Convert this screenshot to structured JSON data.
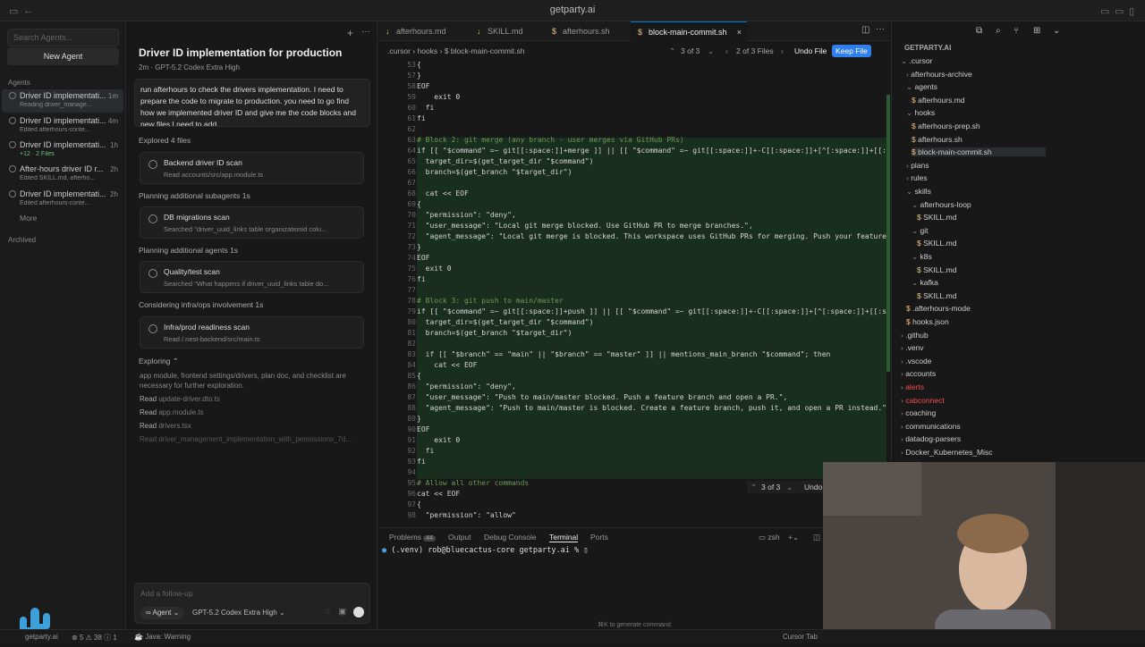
{
  "window": {
    "title": "getparty.ai"
  },
  "sidebar": {
    "search_placeholder": "Search Agents...",
    "new_agent": "New Agent",
    "agents_header": "Agents",
    "archived": "Archived",
    "more": "More",
    "items": [
      {
        "title": "Driver ID implementati...",
        "sub": "Reading driver_manage...",
        "time": "1m"
      },
      {
        "title": "Driver ID implementati...",
        "sub": "Edited afterhours-conte...",
        "time": "4m"
      },
      {
        "title": "Driver ID implementati...",
        "sub": "+12 · 2 Files",
        "time": "1h"
      },
      {
        "title": "After-hours driver ID r...",
        "sub": "Edited SKILL.md, afterho...",
        "time": "2h"
      },
      {
        "title": "Driver ID implementati...",
        "sub": "Edited afterhours-conte...",
        "time": "2h"
      }
    ]
  },
  "chat": {
    "title": "Driver ID implementation for production",
    "meta": "2m · GPT-5.2 Codex Extra High",
    "prompt": "run afterhours to check the drivers implementation. I need to prepare the code to migrate to production.  you need to go find how we implemented driver ID and give me the code blocks and new files I need to add",
    "explored": "Explored 4 files",
    "cards": [
      {
        "title": "Backend driver ID scan",
        "desc": "Read accounts/src/app.module.ts"
      },
      {
        "title": "DB migrations scan",
        "desc": "Searched \"driver_uuid_links table organizationid colu..."
      },
      {
        "title": "Quality/test scan",
        "desc": "Searched \"What happens if driver_uuid_links table do..."
      },
      {
        "title": "Infra/prod readiness scan",
        "desc": "Read /.nest-backend/src/main.ts"
      }
    ],
    "steps": [
      "Planning additional subagents 1s",
      "Planning additional agents 1s",
      "Considering infra/ops involvement 1s"
    ],
    "exploring": "Exploring",
    "exploring_text": "app module, frontend settings/drivers, plan doc, and checklist are necessary for further exploration.",
    "reads": [
      {
        "label": "Read",
        "file": "update-driver.dto.ts"
      },
      {
        "label": "Read",
        "file": "app.module.ts"
      },
      {
        "label": "Read",
        "file": "drivers.tsx"
      },
      {
        "label": "Read",
        "file": "driver_management_implementation_with_permissions_7d..."
      }
    ],
    "followup_placeholder": "Add a follow-up",
    "mode": "Agent",
    "model": "GPT-5.2 Codex Extra High"
  },
  "editor": {
    "tabs": [
      "afterhours.md",
      "SKILL.md",
      "afterhours.sh",
      "block-main-commit.sh"
    ],
    "breadcrumb": ".cursor  ›  hooks  ›  $ block-main-commit.sh",
    "hunk_nav": "3 of 3",
    "file_nav": "2 of 3 Files",
    "undo_file": "Undo File",
    "keep_file": "Keep File",
    "hunk_nav_bottom": "3 of 3",
    "undo": "Undo",
    "lines": [
      {
        "n": "53",
        "t": "{"
      },
      {
        "n": "57",
        "t": "}"
      },
      {
        "n": "58",
        "t": "EOF"
      },
      {
        "n": "59",
        "t": "    exit 0"
      },
      {
        "n": "60",
        "t": "  fi"
      },
      {
        "n": "61",
        "t": "fi"
      },
      {
        "n": "62",
        "t": ""
      },
      {
        "n": "63",
        "t": "# Block 2: git merge (any branch - user merges via GitHub PRs)"
      },
      {
        "n": "64",
        "t": "if [[ \"$command\" =~ git[[:space:]]+merge ]] || [[ \"$command\" =~ git[[:space:]]+-C[[:space:]]+[^[:space:]]+[[:s"
      },
      {
        "n": "65",
        "t": "  target_dir=$(get_target_dir \"$command\")"
      },
      {
        "n": "66",
        "t": "  branch=$(get_branch \"$target_dir\")"
      },
      {
        "n": "67",
        "t": ""
      },
      {
        "n": "68",
        "t": "  cat << EOF"
      },
      {
        "n": "69",
        "t": "{"
      },
      {
        "n": "70",
        "t": "  \"permission\": \"deny\","
      },
      {
        "n": "71",
        "t": "  \"user_message\": \"Local git merge blocked. Use GitHub PR to merge branches.\","
      },
      {
        "n": "72",
        "t": "  \"agent_message\": \"Local git merge is blocked. This workspace uses GitHub PRs for merging. Push your feature"
      },
      {
        "n": "73",
        "t": "}"
      },
      {
        "n": "74",
        "t": "EOF"
      },
      {
        "n": "75",
        "t": "  exit 0"
      },
      {
        "n": "76",
        "t": "fi"
      },
      {
        "n": "77",
        "t": ""
      },
      {
        "n": "78",
        "t": "# Block 3: git push to main/master"
      },
      {
        "n": "79",
        "t": "if [[ \"$command\" =~ git[[:space:]]+push ]] || [[ \"$command\" =~ git[[:space:]]+-C[[:space:]]+[^[:space:]]+[[:sp"
      },
      {
        "n": "80",
        "t": "  target_dir=$(get_target_dir \"$command\")"
      },
      {
        "n": "81",
        "t": "  branch=$(get_branch \"$target_dir\")"
      },
      {
        "n": "82",
        "t": ""
      },
      {
        "n": "83",
        "t": "  if [[ \"$branch\" == \"main\" || \"$branch\" == \"master\" ]] || mentions_main_branch \"$command\"; then"
      },
      {
        "n": "84",
        "t": "    cat << EOF"
      },
      {
        "n": "85",
        "t": "{"
      },
      {
        "n": "86",
        "t": "  \"permission\": \"deny\","
      },
      {
        "n": "87",
        "t": "  \"user_message\": \"Push to main/master blocked. Push a feature branch and open a PR.\","
      },
      {
        "n": "88",
        "t": "  \"agent_message\": \"Push to main/master is blocked. Create a feature branch, push it, and open a PR instead.\""
      },
      {
        "n": "89",
        "t": "}"
      },
      {
        "n": "90",
        "t": "EOF"
      },
      {
        "n": "91",
        "t": "    exit 0"
      },
      {
        "n": "92",
        "t": "  fi"
      },
      {
        "n": "93",
        "t": "fi"
      },
      {
        "n": "94",
        "t": ""
      },
      {
        "n": "95",
        "t": "# Allow all other commands"
      },
      {
        "n": "96",
        "t": "cat << EOF"
      },
      {
        "n": "97",
        "t": "{"
      },
      {
        "n": "98",
        "t": "  \"permission\": \"allow\""
      }
    ]
  },
  "explorer": {
    "root": "GETPARTY.AI",
    "items": [
      {
        "label": ".cursor",
        "type": "folder-open",
        "depth": 1
      },
      {
        "label": "afterhours-archive",
        "type": "folder",
        "depth": 2
      },
      {
        "label": "agents",
        "type": "folder-open",
        "depth": 2
      },
      {
        "label": "afterhours.md",
        "type": "file",
        "depth": 3
      },
      {
        "label": "hooks",
        "type": "folder-open",
        "depth": 2
      },
      {
        "label": "afterhours-prep.sh",
        "type": "file",
        "depth": 3
      },
      {
        "label": "afterhours.sh",
        "type": "file",
        "depth": 3
      },
      {
        "label": "block-main-commit.sh",
        "type": "file",
        "depth": 3
      },
      {
        "label": "plans",
        "type": "folder",
        "depth": 2
      },
      {
        "label": "rules",
        "type": "folder",
        "depth": 2
      },
      {
        "label": "skills",
        "type": "folder-open",
        "depth": 2
      },
      {
        "label": "afterhours-loop",
        "type": "folder-open",
        "depth": 3
      },
      {
        "label": "SKILL.md",
        "type": "file",
        "depth": 4
      },
      {
        "label": "git",
        "type": "folder-open",
        "depth": 3
      },
      {
        "label": "SKILL.md",
        "type": "file",
        "depth": 4
      },
      {
        "label": "k8s",
        "type": "folder-open",
        "depth": 3
      },
      {
        "label": "SKILL.md",
        "type": "file",
        "depth": 4
      },
      {
        "label": "kafka",
        "type": "folder-open",
        "depth": 3
      },
      {
        "label": "SKILL.md",
        "type": "file",
        "depth": 4
      },
      {
        "label": ".afterhours-mode",
        "type": "file",
        "depth": 2
      },
      {
        "label": "hooks.json",
        "type": "file",
        "depth": 2
      },
      {
        "label": ".github",
        "type": "folder",
        "depth": 1
      },
      {
        "label": ".venv",
        "type": "folder",
        "depth": 1
      },
      {
        "label": ".vscode",
        "type": "folder",
        "depth": 1
      },
      {
        "label": "accounts",
        "type": "folder",
        "depth": 1
      },
      {
        "label": "alerts",
        "type": "folder",
        "depth": 1
      },
      {
        "label": "cabconnect",
        "type": "folder",
        "depth": 1
      },
      {
        "label": "coaching",
        "type": "folder",
        "depth": 1
      },
      {
        "label": "communications",
        "type": "folder",
        "depth": 1
      },
      {
        "label": "datadog-parsers",
        "type": "folder",
        "depth": 1
      },
      {
        "label": "Docker_Kubernetes_Misc",
        "type": "folder",
        "depth": 1
      }
    ]
  },
  "panel": {
    "tabs": [
      "Problems",
      "Output",
      "Debug Console",
      "Terminal",
      "Ports"
    ],
    "problems_count": "44",
    "shell": "zsh",
    "prompt": "(.venv) rob@bluecactus-core getparty.ai % ",
    "hint": "⌘K to generate command"
  },
  "statusbar": {
    "left": "getparty.ai",
    "errors": "5",
    "warnings": "38",
    "info": "1",
    "java": "Java: Warning",
    "right": "Cursor Tab"
  },
  "colors": {
    "accent": "#0078d4",
    "keep": "#2f80ed",
    "added_bg": "#1f3323",
    "red_folder": "#f14c4c"
  }
}
